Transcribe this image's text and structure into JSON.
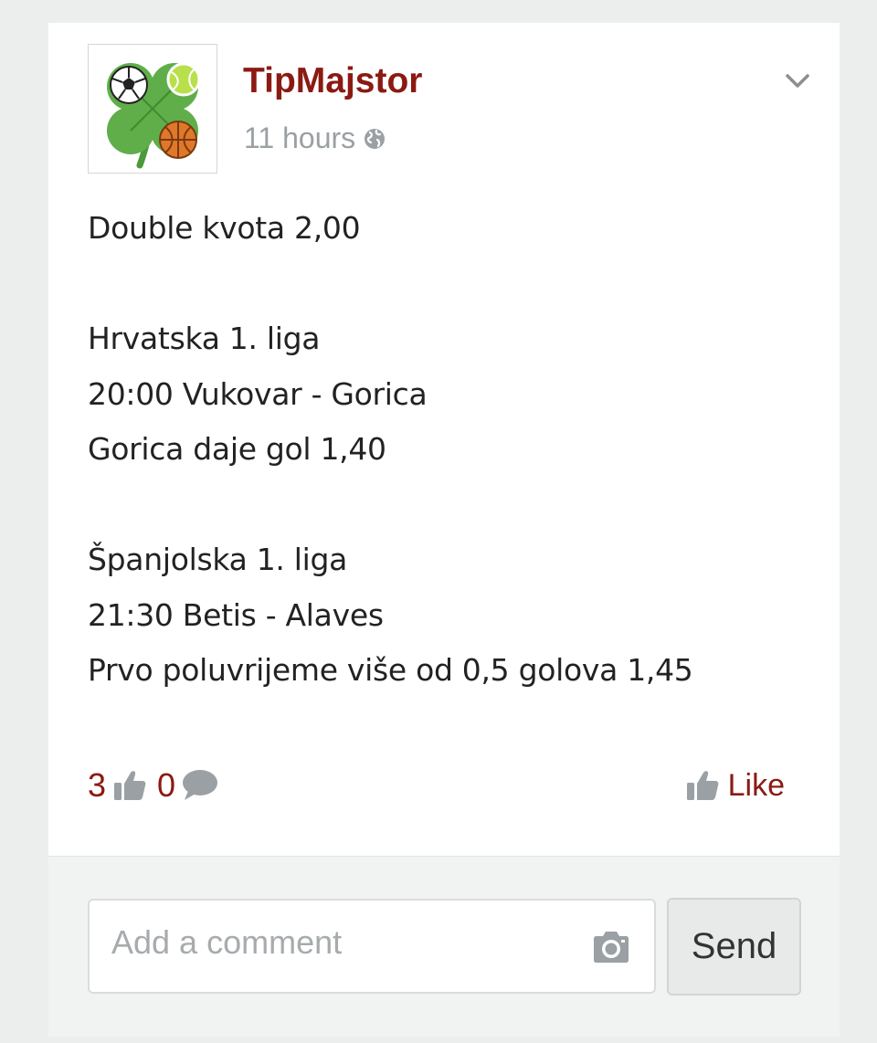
{
  "post": {
    "author": "TipMajstor",
    "timestamp": "11 hours",
    "visibility_icon": "globe-icon",
    "avatar_icon": "four-leaf-clover-sports-logo",
    "menu_icon": "chevron-down-icon",
    "lines": [
      "Double kvota 2,00",
      "",
      "Hrvatska 1. liga",
      "20:00 Vukovar - Gorica",
      "Gorica daje gol 1,40",
      "",
      "Španjolska 1. liga",
      "21:30 Betis - Alaves",
      "Prvo poluvrijeme više od 0,5 golova 1,45"
    ]
  },
  "stats": {
    "likes": "3",
    "comments": "0",
    "like_icon": "thumbs-up-icon",
    "comment_icon": "speech-bubble-icon"
  },
  "actions": {
    "like_label": "Like"
  },
  "comment": {
    "placeholder": "Add a comment",
    "value": "",
    "camera_icon": "camera-icon",
    "send_label": "Send"
  },
  "colors": {
    "accent": "#8b1a12",
    "muted": "#9aa0a3",
    "text": "#222222",
    "background": "#eceeee"
  }
}
